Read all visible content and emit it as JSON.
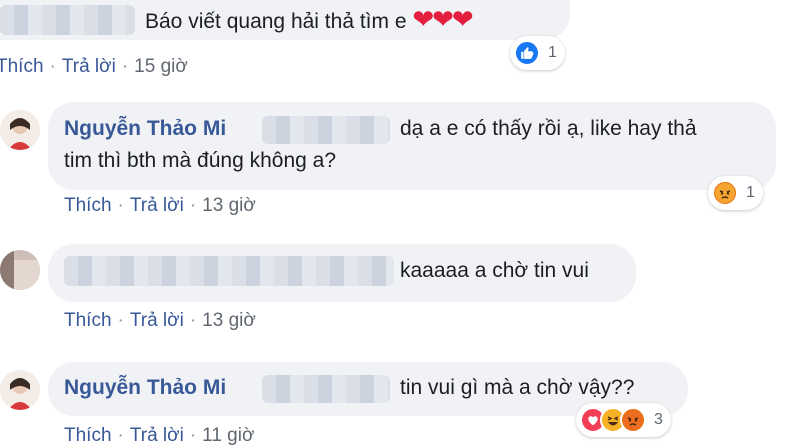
{
  "comments": [
    {
      "text": "Báo viết quang hải thả tìm e",
      "hearts": "❤❤❤",
      "reaction_count": "1",
      "actions": {
        "like": "Thích",
        "reply": "Trả lời",
        "time": "15 giờ"
      }
    },
    {
      "author": "Nguyễn Thảo Mi",
      "text_line1": "dạ a e có thấy rồi ạ, like hay thả",
      "text_line2": "tim thì bth mà đúng không a?",
      "reaction_count": "1",
      "actions": {
        "like": "Thích",
        "reply": "Trả lời",
        "time": "13 giờ"
      }
    },
    {
      "text": "kaaaaa a chờ tin vui",
      "actions": {
        "like": "Thích",
        "reply": "Trả lời",
        "time": "13 giờ"
      }
    },
    {
      "author": "Nguyễn Thảo Mi",
      "text": "tin vui gì mà a chờ vậy??",
      "reaction_count": "3",
      "actions": {
        "like": "Thích",
        "reply": "Trả lời",
        "time": "11 giờ"
      }
    }
  ],
  "separator": "·",
  "colors": {
    "link": "#385898",
    "bubble": "#f0f2f5",
    "like_blue": "#1877f2",
    "angry_orange": "#e9710f"
  }
}
